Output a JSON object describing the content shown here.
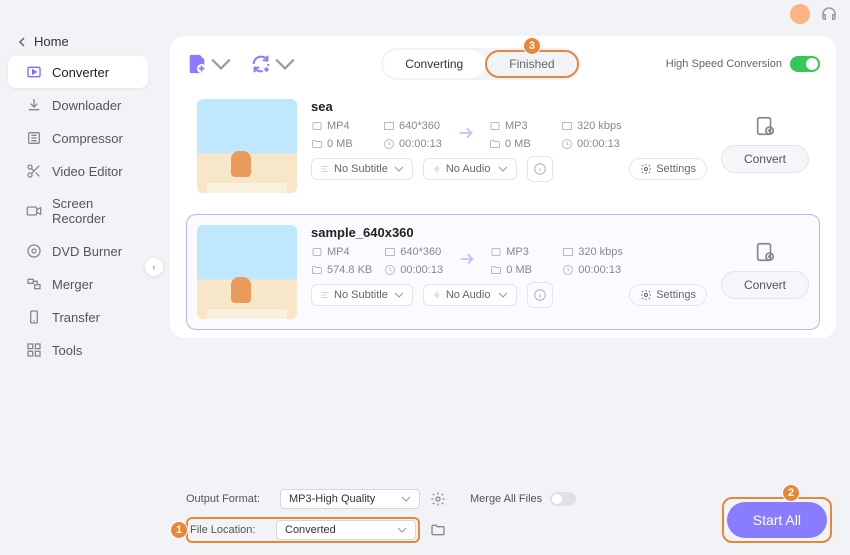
{
  "home_label": "Home",
  "sidebar": {
    "items": [
      {
        "label": "Converter",
        "active": true
      },
      {
        "label": "Downloader"
      },
      {
        "label": "Compressor"
      },
      {
        "label": "Video Editor"
      },
      {
        "label": "Screen Recorder"
      },
      {
        "label": "DVD Burner"
      },
      {
        "label": "Merger"
      },
      {
        "label": "Transfer"
      },
      {
        "label": "Tools"
      }
    ]
  },
  "tabs": {
    "converting": "Converting",
    "finished": "Finished"
  },
  "high_speed_label": "High Speed Conversion",
  "files": [
    {
      "title": "sea",
      "src_format": "MP4",
      "src_res": "640*360",
      "src_size": "0 MB",
      "src_dur": "00:00:13",
      "dst_format": "MP3",
      "dst_rate": "320 kbps",
      "dst_size": "0 MB",
      "dst_dur": "00:00:13",
      "subtitle": "No Subtitle",
      "audio": "No Audio",
      "settings_label": "Settings",
      "convert_label": "Convert"
    },
    {
      "title": "sample_640x360",
      "src_format": "MP4",
      "src_res": "640*360",
      "src_size": "574.8 KB",
      "src_dur": "00:00:13",
      "dst_format": "MP3",
      "dst_rate": "320 kbps",
      "dst_size": "0 MB",
      "dst_dur": "00:00:13",
      "subtitle": "No Subtitle",
      "audio": "No Audio",
      "settings_label": "Settings",
      "convert_label": "Convert"
    }
  ],
  "footer": {
    "output_format_label": "Output Format:",
    "output_format_value": "MP3-High Quality",
    "file_location_label": "File Location:",
    "file_location_value": "Converted",
    "merge_label": "Merge All Files",
    "start_all_label": "Start All"
  },
  "annotations": {
    "a1": "1",
    "a2": "2",
    "a3": "3"
  }
}
